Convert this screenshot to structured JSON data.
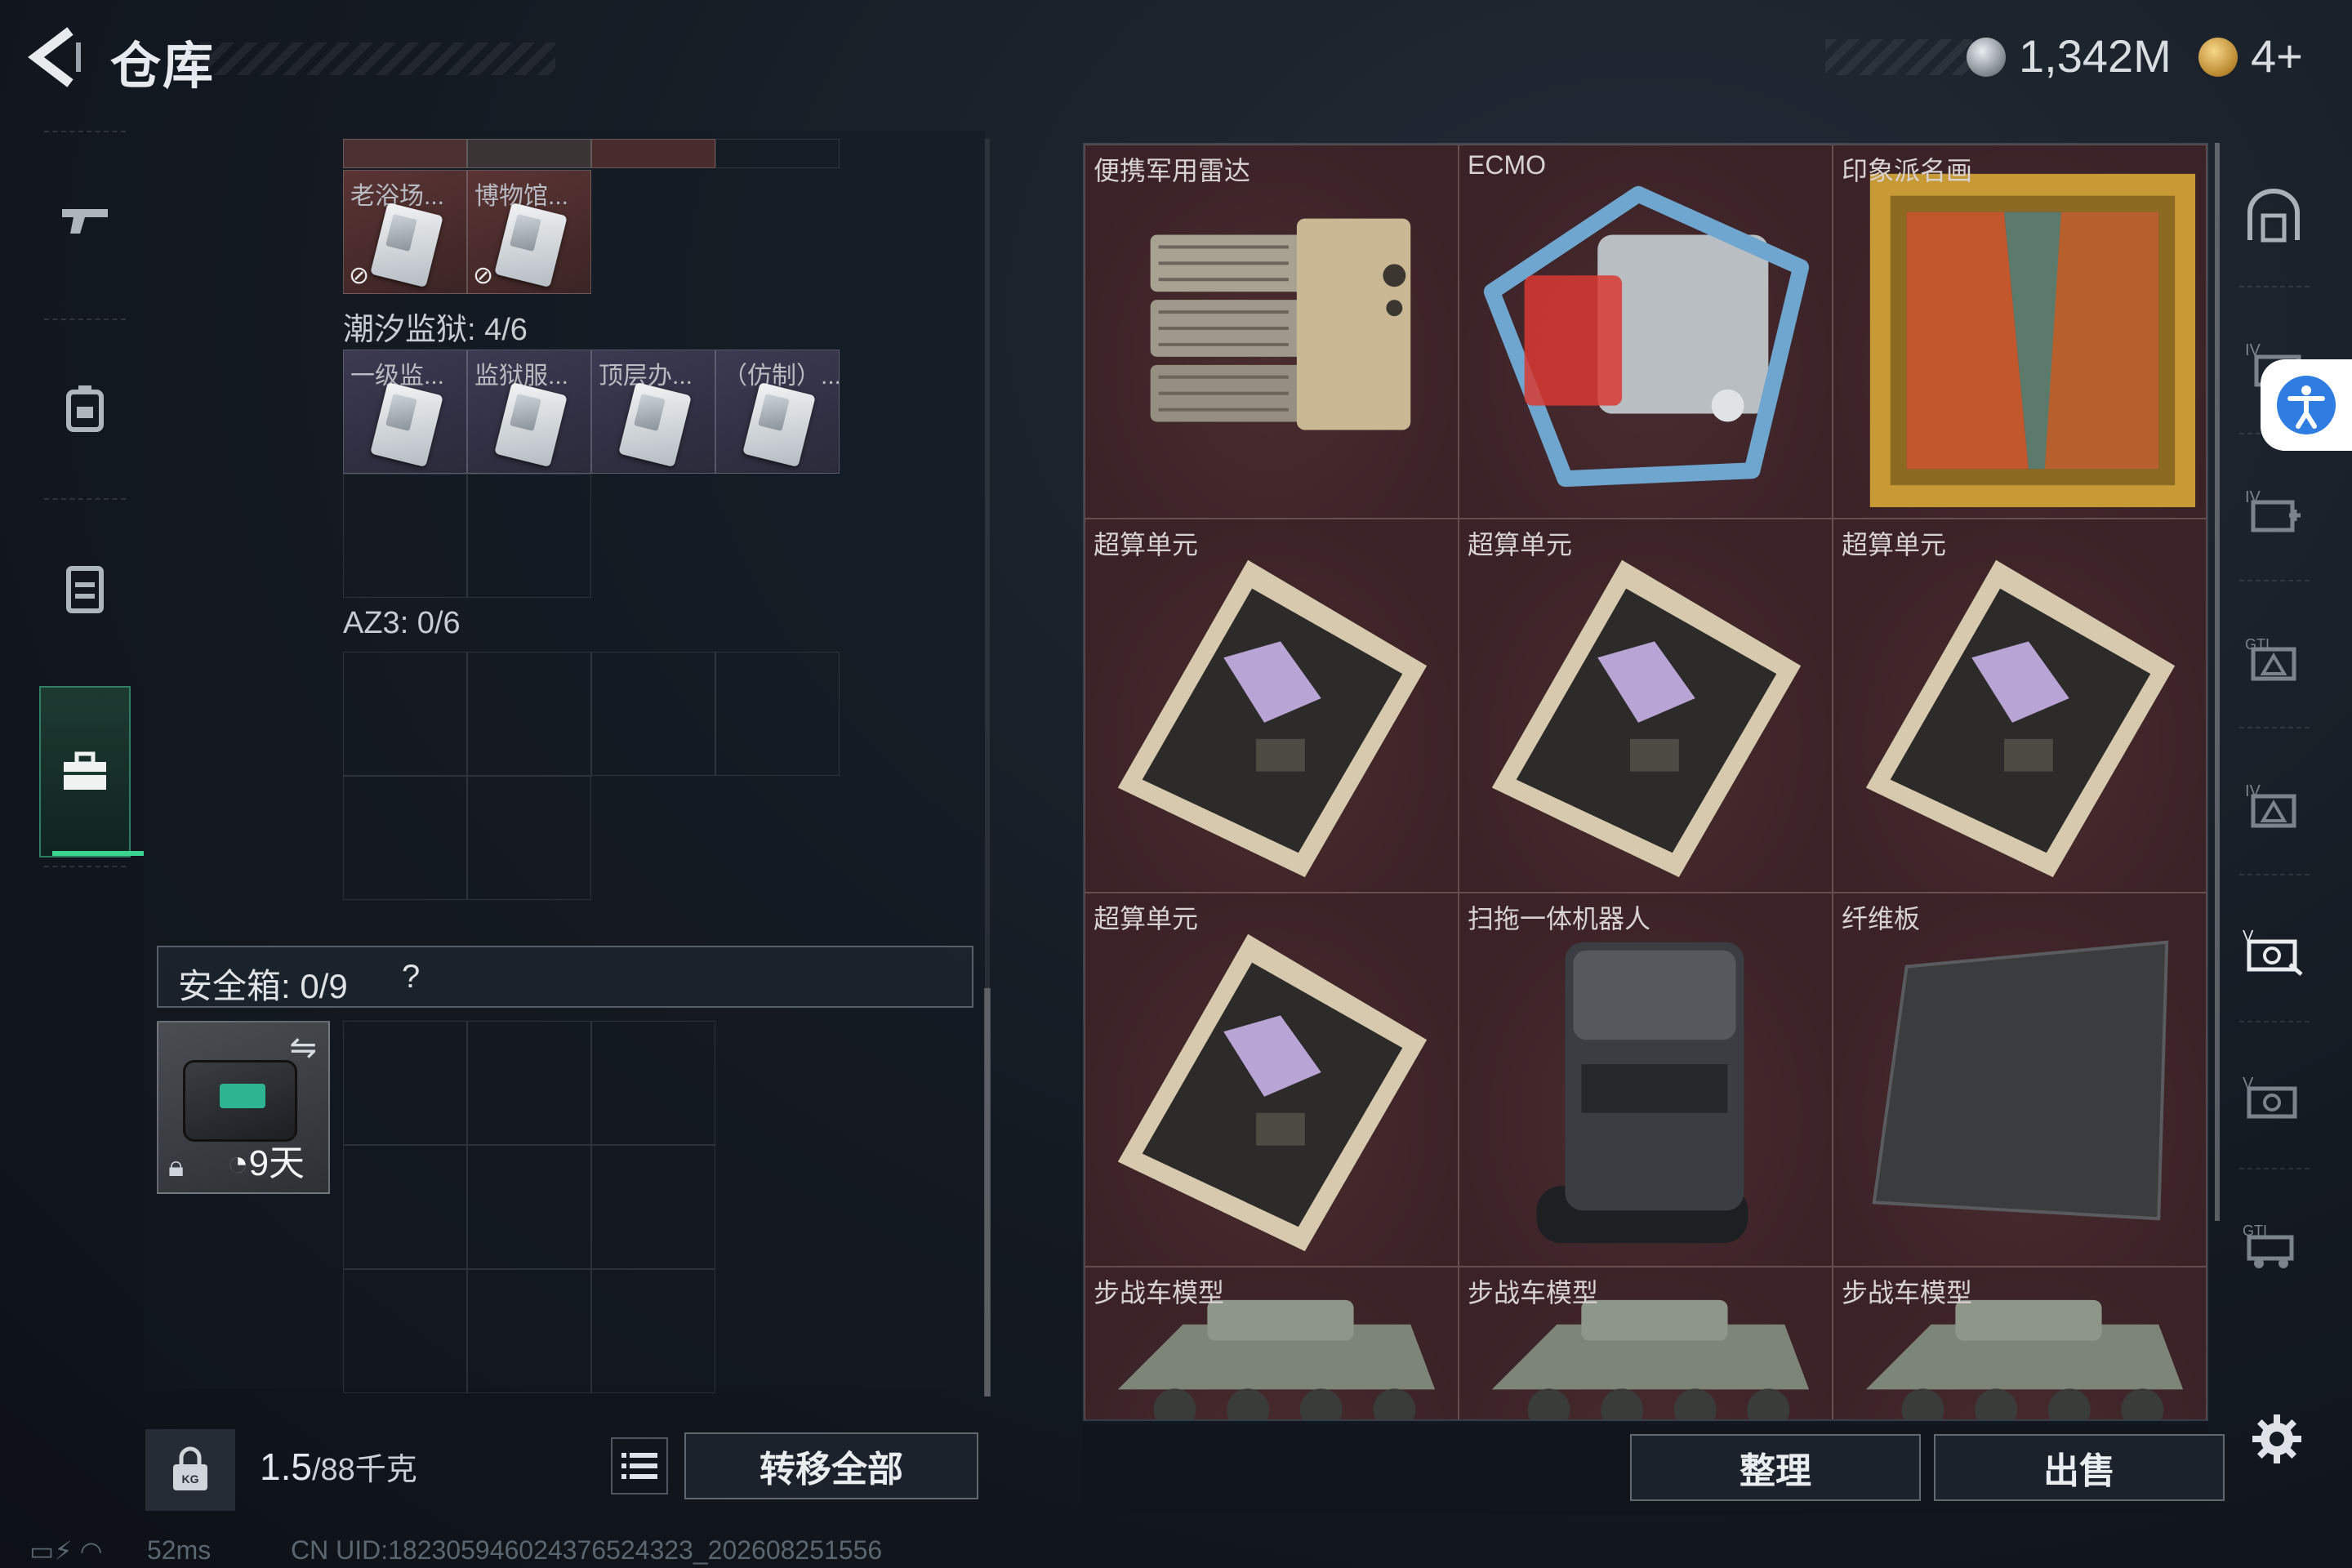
{
  "header": {
    "title": "仓库",
    "money": "1,342M",
    "tickets": "4+"
  },
  "left_nav": [
    "gun-icon",
    "backpack-icon",
    "vest-icon",
    "toolbox-icon"
  ],
  "storage": {
    "top_items": [
      {
        "label": "老浴场..."
      },
      {
        "label": "博物馆..."
      }
    ],
    "section_tide": "潮汐监狱: 4/6",
    "tide_items": [
      {
        "label": "一级监..."
      },
      {
        "label": "监狱服..."
      },
      {
        "label": "顶层办..."
      },
      {
        "label": "（仿制）..."
      }
    ],
    "section_az3": "AZ3: 0/6"
  },
  "safe": {
    "label": "安全箱: 0/9",
    "help": "?",
    "timer": "9天"
  },
  "footer_left": {
    "weight_main": "1.5",
    "weight_rest": "/88千克",
    "transfer_all": "转移全部"
  },
  "status": {
    "ping": "52ms",
    "uid": "CN UID:1823059460243765243​23_202608251556"
  },
  "right_items": [
    {
      "label": "便携军用雷达",
      "art": "radar"
    },
    {
      "label": "ECMO",
      "art": "ecmo"
    },
    {
      "label": "印象派名画",
      "art": "painting"
    },
    {
      "label": "超算单元",
      "art": "gpu"
    },
    {
      "label": "超算单元",
      "art": "gpu"
    },
    {
      "label": "超算单元",
      "art": "gpu"
    },
    {
      "label": "超算单元",
      "art": "gpu"
    },
    {
      "label": "扫拖一体机器人",
      "art": "robot"
    },
    {
      "label": "纤维板",
      "art": "fiber"
    },
    {
      "label": "步战车模型",
      "art": "tank"
    },
    {
      "label": "步战车模型",
      "art": "tank"
    },
    {
      "label": "步战车模型",
      "art": "tank"
    }
  ],
  "footer_right": {
    "sort": "整理",
    "sell": "出售"
  },
  "right_nav": [
    "shelter-icon",
    "folder-icon",
    "medkit-icon",
    "gti-warning-icon",
    "iv-warning-icon",
    "vault-icon",
    "vault-v-icon",
    "gti-truck-icon"
  ]
}
